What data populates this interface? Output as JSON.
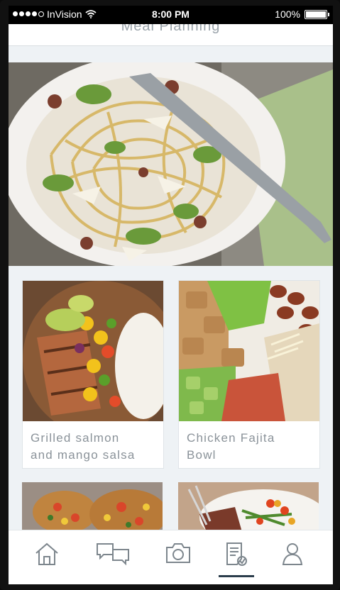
{
  "status_bar": {
    "carrier": "InVision",
    "time": "8:00 PM",
    "battery": "100%"
  },
  "header": {
    "title": "Meal Planning"
  },
  "hero": {
    "image_icon": "pasta-dish-image"
  },
  "recipes": [
    {
      "title": "Grilled salmon\nand mango salsa",
      "image_icon": "salmon-mango-salsa-image"
    },
    {
      "title": "Chicken Fajita\nBowl",
      "image_icon": "chicken-fajita-bowl-image"
    },
    {
      "title": "",
      "image_icon": "pizza-image"
    },
    {
      "title": "",
      "image_icon": "steak-vegetables-image"
    }
  ],
  "tab_bar": {
    "items": [
      {
        "icon": "home-icon"
      },
      {
        "icon": "chat-icon"
      },
      {
        "icon": "camera-icon"
      },
      {
        "icon": "recipe-icon",
        "active": true
      },
      {
        "icon": "profile-icon"
      }
    ]
  },
  "colors": {
    "background": "#eef2f5",
    "label_text": "#8a9299",
    "icon_stroke": "#7d868d",
    "active_indicator": "#2b3d4c"
  }
}
